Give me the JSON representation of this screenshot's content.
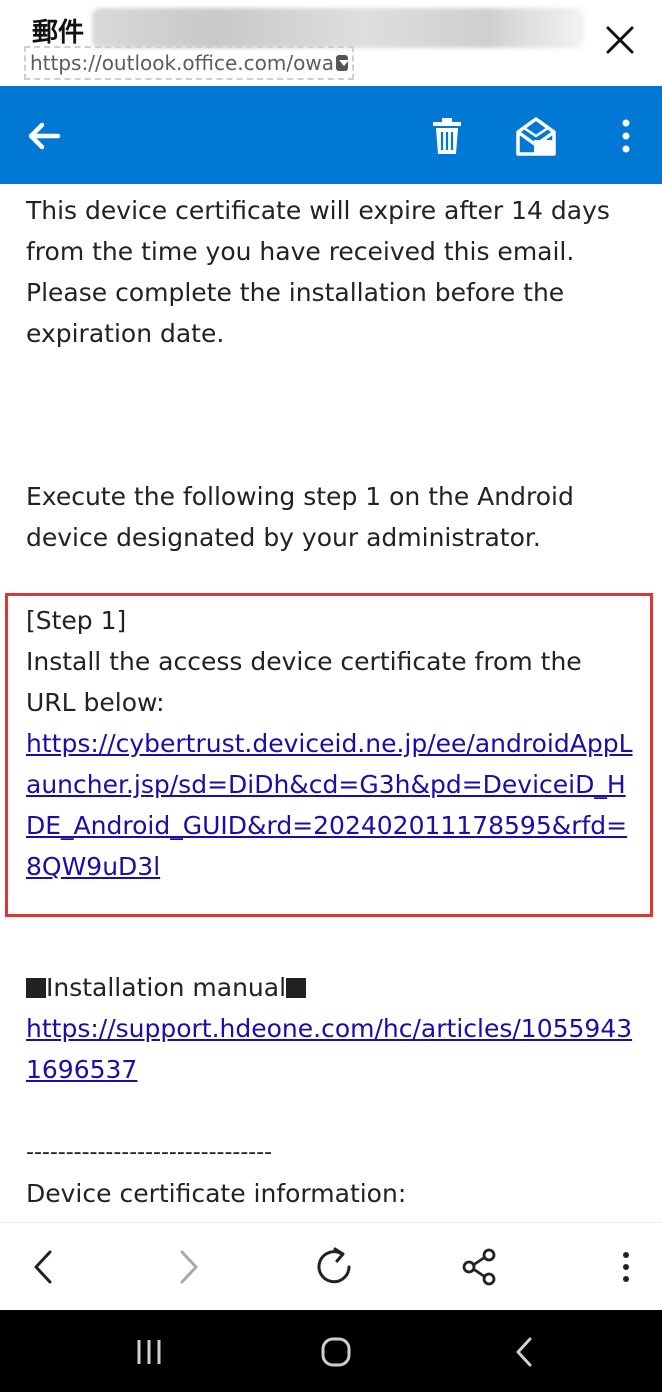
{
  "titlebar": {
    "title": "郵件",
    "url": "https://outlook.office.com/owa",
    "icons": {
      "dropdown": "chevron-down-icon",
      "close": "close-icon"
    }
  },
  "toolbar": {
    "color": "#0078d4",
    "icons": [
      "arrow-left-icon",
      "trash-icon",
      "mark-read-icon",
      "more-vertical-icon"
    ]
  },
  "email": {
    "para1": "This device certificate will expire after 14 days from the time you have received this email. Please complete the installation before the expiration date.",
    "para2": "Execute the following step 1 on the Android device designated by your administrator.",
    "step_heading": "[Step 1]",
    "step_text": "Install the access device certificate from the URL below:",
    "step_link": "https://cybertrust.deviceid.ne.jp/ee/androidAppLauncher.jsp/sd=DiDh&cd=G3h&pd=DeviceiD_HDE_Android_GUID&rd=202402011178595&rfd=8QW9uD3l",
    "manual_label": "Installation manual",
    "manual_link": "https://support.hdeone.com/hc/articles/10559431696537",
    "divider": "-------------------------------",
    "cert_info_label": "Device certificate information:",
    "highlight_color": "#e03535",
    "link_color": "#1a0dab"
  },
  "browser_nav": {
    "icons": [
      "back-icon",
      "forward-icon",
      "reload-icon",
      "share-icon",
      "more-vertical-icon"
    ]
  },
  "system_nav": {
    "icons": [
      "recent-apps-icon",
      "home-icon",
      "system-back-icon"
    ]
  }
}
